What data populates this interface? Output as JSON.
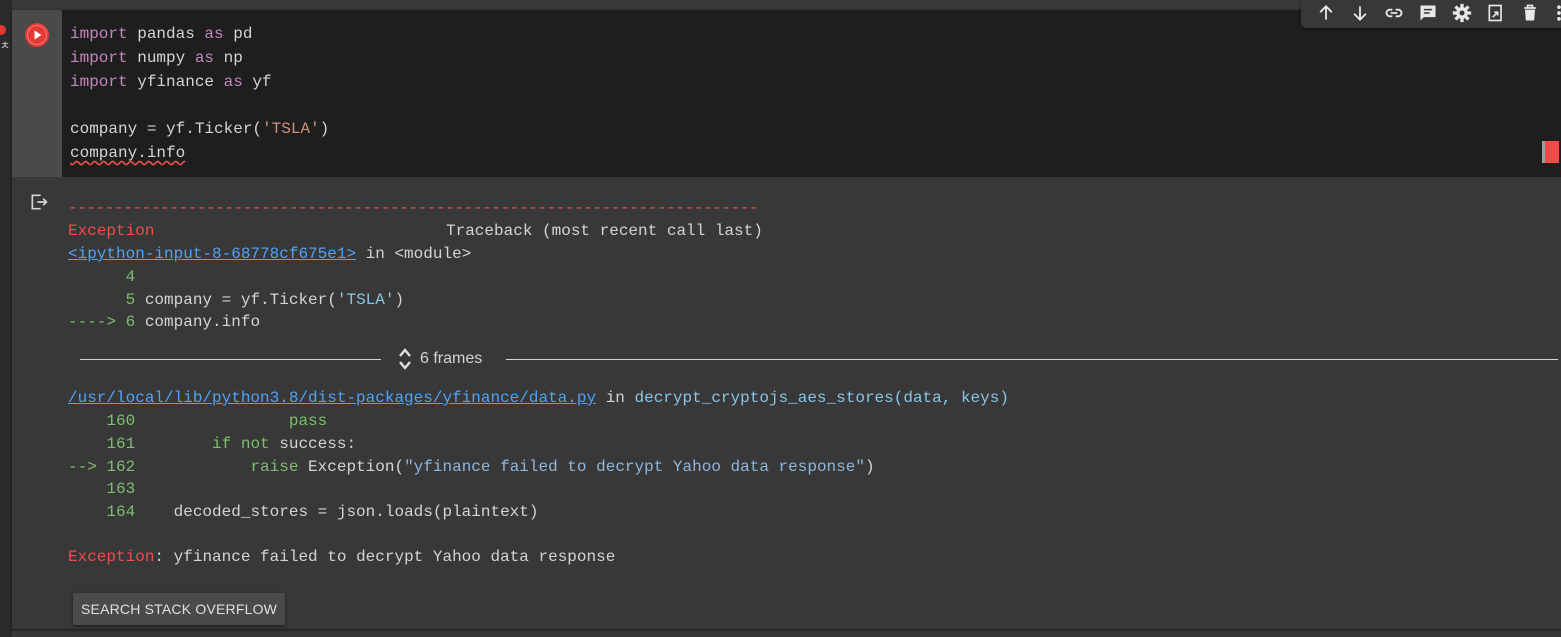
{
  "code": {
    "line1": {
      "kw1": "import",
      "mod": " pandas ",
      "kw2": "as",
      "alias": " pd"
    },
    "line2": {
      "kw1": "import",
      "mod": " numpy ",
      "kw2": "as",
      "alias": " np"
    },
    "line3": {
      "kw1": "import",
      "mod": " yfinance ",
      "kw2": "as",
      "alias": " yf"
    },
    "line5": {
      "pre": "company = yf.Ticker(",
      "str": "'TSLA'",
      "post": ")"
    },
    "line6": "company.info"
  },
  "toolbar": {
    "icons": [
      "arrow-up-icon",
      "arrow-down-icon",
      "link-icon",
      "comment-icon",
      "gear-icon",
      "mirror-cell-icon",
      "trash-icon",
      "more-vert-icon"
    ]
  },
  "output": {
    "dashes": "---------------------------------------------------------------------------",
    "exc_name": "Exception",
    "traceback_header": "Traceback (most recent call last)",
    "input_link": "<ipython-input-8-68778cf675e1>",
    "in_module": " in <module>",
    "l4_num": "      4",
    "l5_num": "      5",
    "l5_pre": " company = yf.Ticker(",
    "l5_str": "'TSLA'",
    "l5_post": ")",
    "l6_arrow": "----> 6",
    "l6_code": " company.info",
    "frames_label": "6 frames",
    "file_link": "/usr/local/lib/python3.8/dist-packages/yfinance/data.py",
    "in_func": " in ",
    "func_sig": "decrypt_cryptojs_aes_stores(data, keys)",
    "f160_num": "    160",
    "f160_code": "                pass",
    "f161_num": "    161",
    "f161_ind": "        ",
    "f161_kw": "if not",
    "f161_rest": " success:",
    "f162_arrow": "--> 162",
    "f162_ind": "            ",
    "f162_kw": "raise",
    "f162_pre": " Exception(",
    "f162_str": "\"yfinance failed to decrypt Yahoo data response\"",
    "f162_post": ")",
    "f163_num": "    163",
    "f164_num": "    164",
    "f164_code": "    decoded_stores = json.loads(plaintext)",
    "final_name": "Exception",
    "final_colon": ":",
    "final_msg": " yfinance failed to decrypt Yahoo data response",
    "so_button": "SEARCH STACK OVERFLOW"
  },
  "strip": {
    "glyph": "ㅊ"
  }
}
